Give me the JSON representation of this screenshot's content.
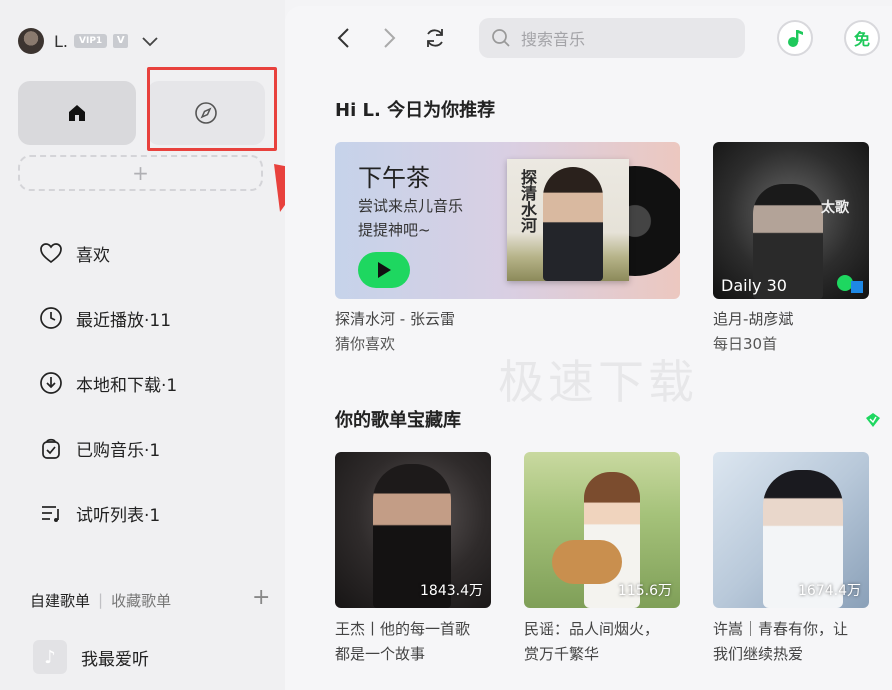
{
  "user": {
    "name": "L.",
    "vip_label": "VIP1",
    "v_label": "V"
  },
  "sidebar": {
    "add_label": "+",
    "menu": [
      {
        "label": "喜欢",
        "icon": "heart-icon"
      },
      {
        "label": "最近播放·11",
        "icon": "clock-icon"
      },
      {
        "label": "本地和下载·1",
        "icon": "download-icon"
      },
      {
        "label": "已购音乐·1",
        "icon": "purchased-icon"
      },
      {
        "label": "试听列表·1",
        "icon": "playlist-icon"
      }
    ],
    "playlist_tabs": {
      "created": "自建歌单",
      "separator": "|",
      "collected": "收藏歌单",
      "add": "+"
    },
    "playlists": [
      {
        "name": "我最爱听"
      }
    ]
  },
  "topbar": {
    "search_placeholder": "搜索音乐",
    "free_label": "免"
  },
  "main": {
    "recommend_title": "Hi L. 今日为你推荐",
    "reco_card": {
      "title": "下午茶",
      "subtitle": "尝试来点儿音乐提提神吧~",
      "album_text": "探清水河"
    },
    "reco_caption_line1": "探清水河 - 张云雷",
    "reco_caption_line2": "猜你喜欢",
    "daily": {
      "label": "Daily 30",
      "art_text": "太歌",
      "caption_line1": "追月-胡彦斌",
      "caption_line2": "每日30首"
    },
    "watermark": "极速下载",
    "treasure_title": "你的歌单宝藏库",
    "playlists": [
      {
        "count": "1843.4万",
        "line1": "王杰丨他的每一首歌",
        "line2": "都是一个故事"
      },
      {
        "count": "115.6万",
        "line1": "民谣：品人间烟火，",
        "line2": "赏万千繁华"
      },
      {
        "count": "1674.4万",
        "line1": "许嵩｜青春有你，让",
        "line2": "我们继续热爱"
      }
    ]
  },
  "colors": {
    "accent": "#1ed760",
    "highlight": "#e8413d"
  }
}
